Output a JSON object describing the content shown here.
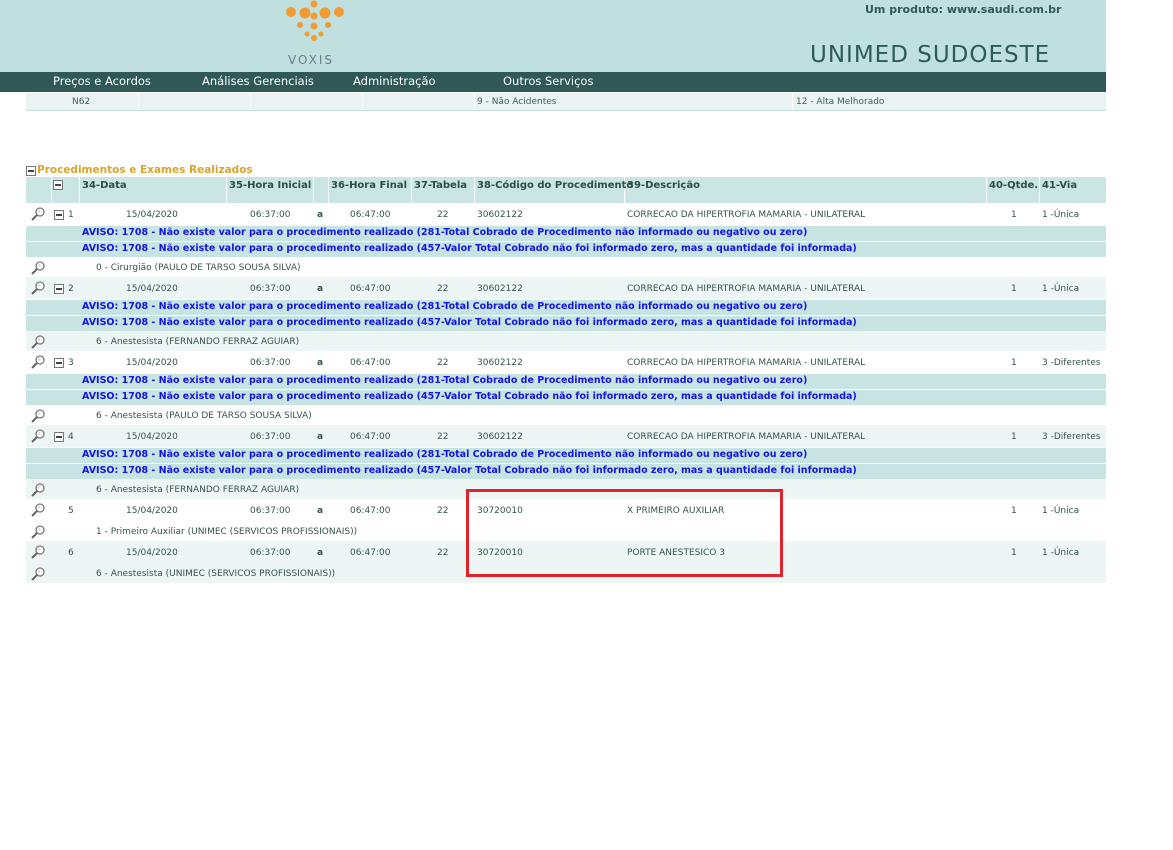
{
  "header": {
    "logo_text": "VOXIS",
    "product": "Um produto: www.saudi.com.br",
    "brand": "UNIMED SUDOESTE"
  },
  "nav": [
    "Preços e Acordos",
    "Análises Gerenciais",
    "Administração",
    "Outros Serviços"
  ],
  "prev_row": {
    "cid": "N62",
    "acidente": "9 - Não Acidentes",
    "saida": "12 - Alta Melhorado"
  },
  "section": {
    "title": "Procedimentos e Exames Realizados",
    "columns": [
      "34-Data",
      "35-Hora Inicial",
      "36-Hora Final",
      "37-Tabela",
      "38-Código do Procedimento",
      "39-Descrição",
      "40-Qtde.",
      "41-Via"
    ]
  },
  "warnings": {
    "w1": "AVISO: 1708 - Não existe valor para o procedimento realizado (281-Total Cobrado de Procedimento não informado ou negativo ou zero)",
    "w2": "AVISO: 1708 - Não existe valor para o procedimento realizado (457-Valor Total Cobrado não foi informado zero, mas a quantidade foi informada)"
  },
  "rows": [
    {
      "n": "1",
      "data": "15/04/2020",
      "hi": "06:37:00",
      "a": "a",
      "hf": "06:47:00",
      "tab": "22",
      "cod": "30602122",
      "desc": "CORRECAO DA HIPERTROFIA MAMARIA - UNILATERAL",
      "qtd": "1",
      "via": "1 -Única",
      "prof": "0 -  Cirurgião  (PAULO DE TARSO SOUSA SILVA)"
    },
    {
      "n": "2",
      "data": "15/04/2020",
      "hi": "06:37:00",
      "a": "a",
      "hf": "06:47:00",
      "tab": "22",
      "cod": "30602122",
      "desc": "CORRECAO DA HIPERTROFIA MAMARIA - UNILATERAL",
      "qtd": "1",
      "via": "1 -Única",
      "prof": "6 -  Anestesista  (FERNANDO FERRAZ AGUIAR)"
    },
    {
      "n": "3",
      "data": "15/04/2020",
      "hi": "06:37:00",
      "a": "a",
      "hf": "06:47:00",
      "tab": "22",
      "cod": "30602122",
      "desc": "CORRECAO DA HIPERTROFIA MAMARIA - UNILATERAL",
      "qtd": "1",
      "via": "3 -Diferentes",
      "prof": "6 -  Anestesista  (PAULO DE TARSO SOUSA SILVA)"
    },
    {
      "n": "4",
      "data": "15/04/2020",
      "hi": "06:37:00",
      "a": "a",
      "hf": "06:47:00",
      "tab": "22",
      "cod": "30602122",
      "desc": "CORRECAO DA HIPERTROFIA MAMARIA - UNILATERAL",
      "qtd": "1",
      "via": "3 -Diferentes",
      "prof": "6 -  Anestesista  (FERNANDO FERRAZ AGUIAR)"
    },
    {
      "n": "5",
      "data": "15/04/2020",
      "hi": "06:37:00",
      "a": "a",
      "hf": "06:47:00",
      "tab": "22",
      "cod": "30720010",
      "desc": "X PRIMEIRO AUXILIAR",
      "qtd": "1",
      "via": "1 -Única",
      "prof": "1 -  Primeiro Auxiliar  (UNIMEC (SERVICOS PROFISSIONAIS))"
    },
    {
      "n": "6",
      "data": "15/04/2020",
      "hi": "06:37:00",
      "a": "a",
      "hf": "06:47:00",
      "tab": "22",
      "cod": "30720010",
      "desc": "PORTE ANESTESICO 3",
      "qtd": "1",
      "via": "1 -Única",
      "prof": "6 -  Anestesista  (UNIMEC (SERVICOS PROFISSIONAIS))"
    }
  ],
  "colors": {
    "header_bg": "#bfe0df",
    "nav_bg": "#2e5956",
    "warning_text": "#1414e6",
    "highlight_box": "#e0222a",
    "section_title": "#d9a428"
  }
}
